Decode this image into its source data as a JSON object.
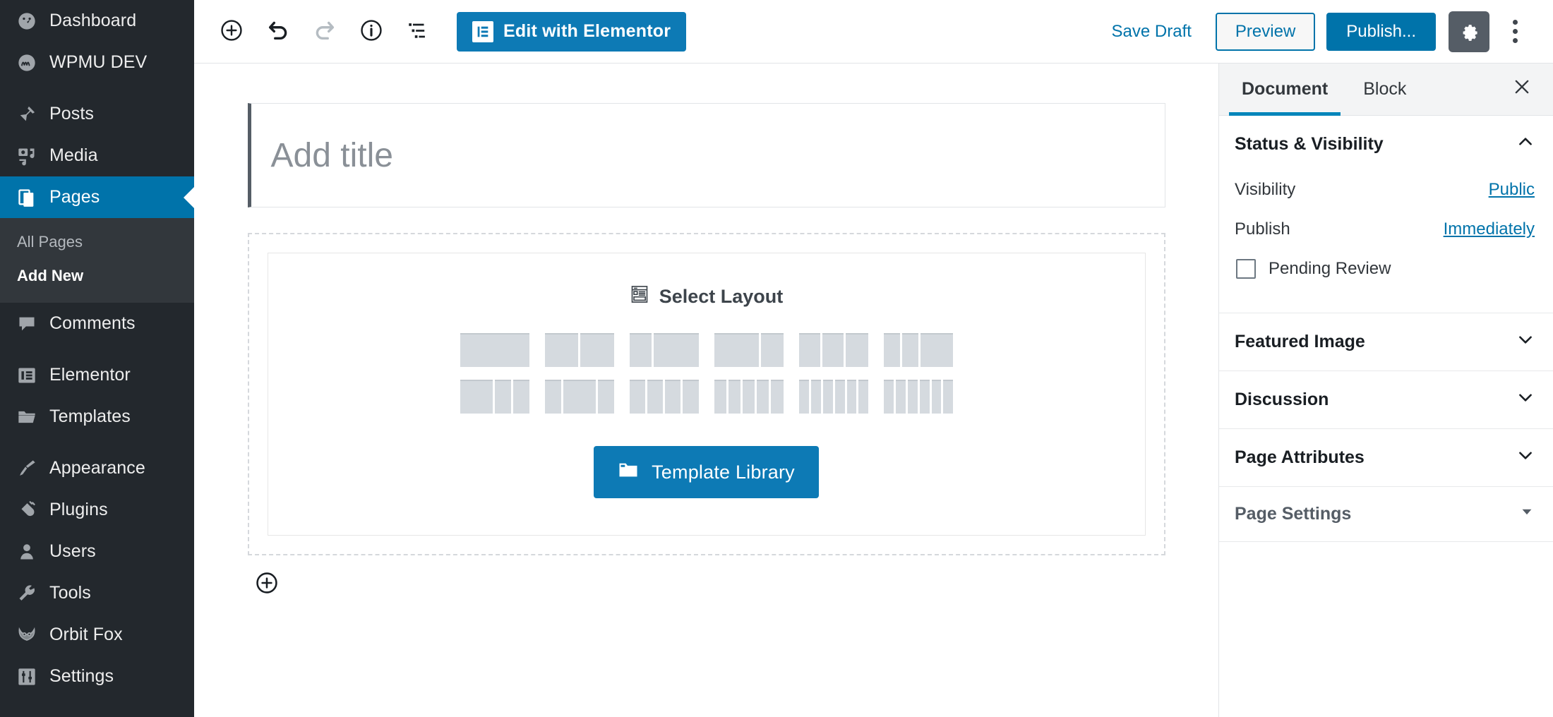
{
  "colors": {
    "wp_blue": "#0073aa",
    "elementor_blue": "#0d7ab5",
    "admin_bg": "#23282d",
    "submenu_bg": "#32373c",
    "accent_tab": "#0085ba",
    "layout_col": "#d5dadf"
  },
  "sidebar": {
    "items": [
      {
        "label": "Dashboard",
        "icon": "dashboard-icon",
        "active": false
      },
      {
        "label": "WPMU DEV",
        "icon": "wpmudev-icon",
        "active": false
      },
      {
        "label": "Posts",
        "icon": "pin-icon",
        "active": false
      },
      {
        "label": "Media",
        "icon": "media-icon",
        "active": false
      },
      {
        "label": "Pages",
        "icon": "pages-icon",
        "active": true
      },
      {
        "label": "Comments",
        "icon": "comment-icon",
        "active": false
      },
      {
        "label": "Elementor",
        "icon": "elementor-icon",
        "active": false
      },
      {
        "label": "Templates",
        "icon": "folder-icon",
        "active": false
      },
      {
        "label": "Appearance",
        "icon": "paintbrush-icon",
        "active": false
      },
      {
        "label": "Plugins",
        "icon": "plug-icon",
        "active": false
      },
      {
        "label": "Users",
        "icon": "user-icon",
        "active": false
      },
      {
        "label": "Tools",
        "icon": "wrench-icon",
        "active": false
      },
      {
        "label": "Orbit Fox",
        "icon": "fox-icon",
        "active": false
      },
      {
        "label": "Settings",
        "icon": "sliders-icon",
        "active": false
      }
    ],
    "submenu": [
      {
        "label": "All Pages",
        "current": false
      },
      {
        "label": "Add New",
        "current": true
      }
    ]
  },
  "toolbar": {
    "add_block_icon": "plus-circle-icon",
    "undo_icon": "undo-icon",
    "redo_icon": "redo-icon",
    "info_icon": "info-circle-icon",
    "list_view_icon": "block-navigation-icon",
    "elementor_button": "Edit with Elementor",
    "save_draft": "Save Draft",
    "preview": "Preview",
    "publish": "Publish...",
    "settings_icon": "gear-icon",
    "more_icon": "more-vertical-icon"
  },
  "editor": {
    "title_placeholder": "Add title",
    "title_value": "",
    "select_layout_label": "Select Layout",
    "select_layout_icon": "layout-preview-icon",
    "template_library_label": "Template Library",
    "template_library_icon": "folder-icon",
    "add_block_bottom_icon": "plus-circle-icon",
    "layout_presets": [
      {
        "name": "1-column",
        "columns": [
          100
        ]
      },
      {
        "name": "2-columns-equal",
        "columns": [
          50,
          50
        ]
      },
      {
        "name": "2-columns-33-67",
        "columns": [
          33,
          67
        ]
      },
      {
        "name": "2-columns-67-33",
        "columns": [
          67,
          33
        ]
      },
      {
        "name": "3-columns-equal",
        "columns": [
          33,
          33,
          34
        ]
      },
      {
        "name": "3-columns-25-25-50",
        "columns": [
          25,
          25,
          50
        ]
      },
      {
        "name": "3-columns-50-25-25",
        "columns": [
          50,
          25,
          25
        ]
      },
      {
        "name": "4-columns-25-50-25",
        "columns": [
          25,
          50,
          25
        ]
      },
      {
        "name": "4-columns-equal",
        "columns": [
          25,
          25,
          25,
          25
        ]
      },
      {
        "name": "5-columns-equal",
        "columns": [
          20,
          20,
          20,
          20,
          20
        ]
      },
      {
        "name": "6-columns-equal",
        "columns": [
          17,
          17,
          17,
          17,
          16,
          16
        ]
      },
      {
        "name": "6-columns-alt",
        "columns": [
          17,
          17,
          17,
          17,
          16,
          16
        ]
      }
    ]
  },
  "settings_panel": {
    "tabs": [
      {
        "label": "Document",
        "active": true
      },
      {
        "label": "Block",
        "active": false
      }
    ],
    "close_icon": "close-icon",
    "sections": [
      {
        "title": "Status & Visibility",
        "expanded": true,
        "chevron": "chevron-up-icon",
        "rows": [
          {
            "label": "Visibility",
            "value": "Public"
          },
          {
            "label": "Publish",
            "value": "Immediately"
          }
        ],
        "checkbox": {
          "label": "Pending Review",
          "checked": false
        }
      },
      {
        "title": "Featured Image",
        "expanded": false,
        "chevron": "chevron-down-icon"
      },
      {
        "title": "Discussion",
        "expanded": false,
        "chevron": "chevron-down-icon"
      },
      {
        "title": "Page Attributes",
        "expanded": false,
        "chevron": "chevron-down-icon"
      },
      {
        "title": "Page Settings",
        "expanded": false,
        "chevron": "caret-down-icon",
        "muted": true
      }
    ]
  }
}
